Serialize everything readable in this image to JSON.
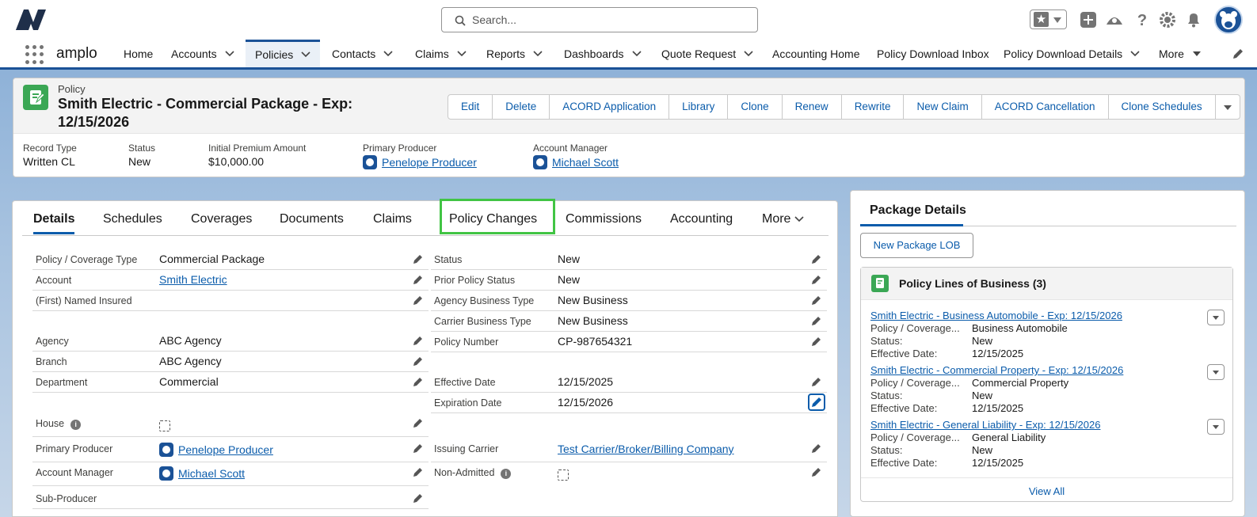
{
  "search": {
    "placeholder": "Search..."
  },
  "app": {
    "name": "amplo"
  },
  "nav": {
    "items": [
      {
        "label": "Home"
      },
      {
        "label": "Accounts"
      },
      {
        "label": "Policies"
      },
      {
        "label": "Contacts"
      },
      {
        "label": "Claims"
      },
      {
        "label": "Reports"
      },
      {
        "label": "Dashboards"
      },
      {
        "label": "Quote Request"
      },
      {
        "label": "Accounting Home"
      },
      {
        "label": "Policy Download Inbox"
      },
      {
        "label": "Policy Download Details"
      },
      {
        "label": "More"
      }
    ]
  },
  "record": {
    "object_label": "Policy",
    "title": "Smith Electric - Commercial Package - Exp: 12/15/2026",
    "actions": [
      "Edit",
      "Delete",
      "ACORD Application",
      "Library",
      "Clone",
      "Renew",
      "Rewrite",
      "New Claim",
      "ACORD Cancellation",
      "Clone Schedules"
    ],
    "highlights": [
      {
        "label": "Record Type",
        "value": "Written CL"
      },
      {
        "label": "Status",
        "value": "New"
      },
      {
        "label": "Initial Premium Amount",
        "value": "$10,000.00"
      },
      {
        "label": "Primary Producer",
        "value": "Penelope Producer"
      },
      {
        "label": "Account Manager",
        "value": "Michael Scott"
      }
    ]
  },
  "tabs": [
    "Details",
    "Schedules",
    "Coverages",
    "Documents",
    "Claims",
    "Policy Changes",
    "Commissions",
    "Accounting",
    "More"
  ],
  "left_fields": [
    {
      "label": "Policy / Coverage Type",
      "value": "Commercial Package"
    },
    {
      "label": "Account",
      "value": "Smith Electric"
    },
    {
      "label": "(First) Named Insured",
      "value": ""
    },
    {
      "label": "Agency",
      "value": "ABC Agency"
    },
    {
      "label": "Branch",
      "value": "ABC Agency"
    },
    {
      "label": "Department",
      "value": "Commercial"
    },
    {
      "label": "House",
      "value": ""
    },
    {
      "label": "Primary Producer",
      "value": "Penelope Producer"
    },
    {
      "label": "Account Manager",
      "value": "Michael Scott"
    },
    {
      "label": "Sub-Producer",
      "value": ""
    }
  ],
  "right_fields": [
    {
      "label": "Status",
      "value": "New"
    },
    {
      "label": "Prior Policy Status",
      "value": "New"
    },
    {
      "label": "Agency Business Type",
      "value": "New Business"
    },
    {
      "label": "Carrier Business Type",
      "value": "New Business"
    },
    {
      "label": "Policy Number",
      "value": "CP-987654321"
    },
    {
      "label": "Effective Date",
      "value": "12/15/2025"
    },
    {
      "label": "Expiration Date",
      "value": "12/15/2026"
    },
    {
      "label": "Issuing Carrier",
      "value": "Test Carrier/Broker/Billing Company"
    },
    {
      "label": "Non-Admitted",
      "value": ""
    }
  ],
  "package": {
    "title": "Package Details",
    "new_button": "New Package LOB",
    "related_title": "Policy Lines of Business (3)",
    "row_labels": {
      "coverage": "Policy / Coverage...",
      "status": "Status:",
      "effective": "Effective Date:"
    },
    "lobs": [
      {
        "name": "Smith Electric - Business Automobile - Exp: 12/15/2026",
        "coverage": "Business Automobile",
        "status": "New",
        "effective": "12/15/2025"
      },
      {
        "name": "Smith Electric - Commercial Property - Exp: 12/15/2026",
        "coverage": "Commercial Property",
        "status": "New",
        "effective": "12/15/2025"
      },
      {
        "name": "Smith Electric - General Liability - Exp: 12/15/2026",
        "coverage": "General Liability",
        "status": "New",
        "effective": "12/15/2025"
      }
    ],
    "view_all": "View All"
  },
  "colors": {
    "brand": "#1b5297",
    "link": "#0b5cab",
    "highlight_border": "#41c444",
    "record_icon": "#3ba755"
  },
  "icons": [
    "search-icon",
    "star-icon",
    "add-icon",
    "trailhead-icon",
    "help-icon",
    "gear-icon",
    "bell-icon",
    "avatar",
    "waffle-icon",
    "pencil-icon",
    "info-icon"
  ]
}
